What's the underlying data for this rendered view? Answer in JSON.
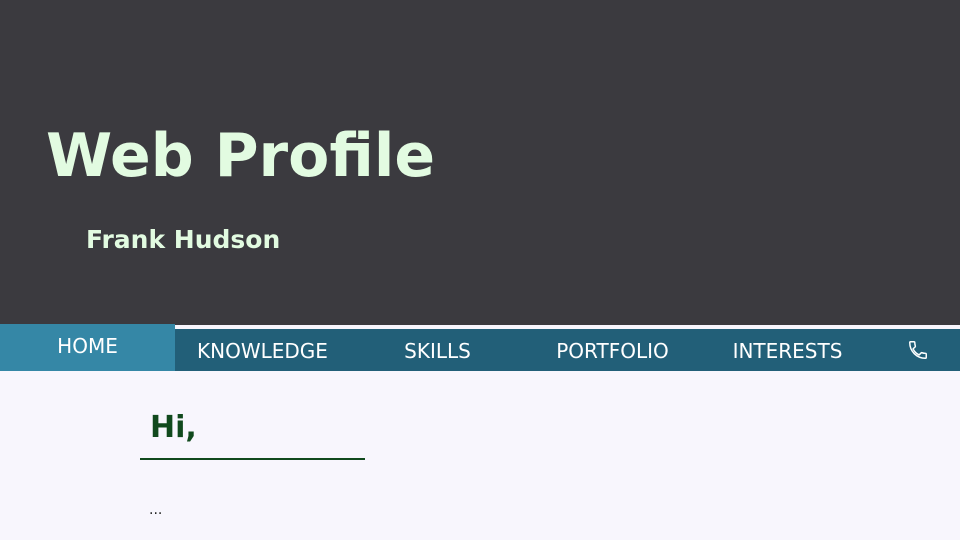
{
  "header": {
    "title": "Web Profile",
    "subtitle": "Frank Hudson"
  },
  "nav": {
    "items": [
      {
        "label": "HOME"
      },
      {
        "label": "KNOWLEDGE"
      },
      {
        "label": "SKILLS"
      },
      {
        "label": "PORTFOLIO"
      },
      {
        "label": "INTERESTS"
      }
    ],
    "active": "HOME",
    "phone_icon": "phone-icon"
  },
  "main": {
    "greeting": "Hi,",
    "body": "..."
  },
  "colors": {
    "header_bg": "#3b3a3f",
    "header_text": "#e2fbe1",
    "nav_bg": "#225f78",
    "nav_active_bg": "#3587a6",
    "greeting_color": "#11491d",
    "page_bg": "#f8f6fd"
  }
}
